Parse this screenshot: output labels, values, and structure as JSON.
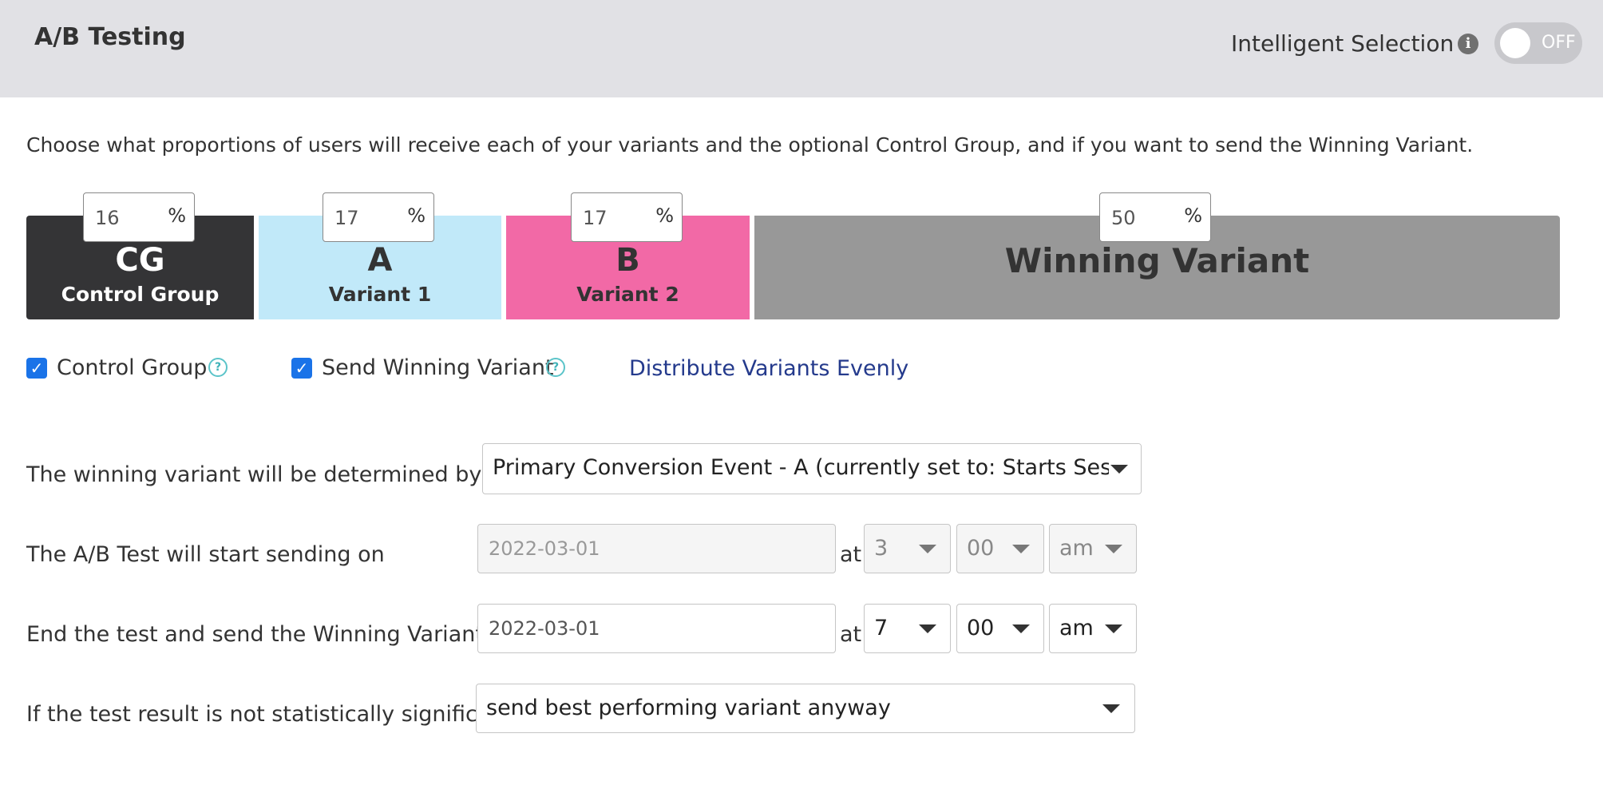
{
  "header": {
    "title": "A/B Testing",
    "intelligent_selection_label": "Intelligent Selection",
    "toggle_label": "OFF"
  },
  "description": "Choose what proportions of users will receive each of your variants and the optional Control Group, and if you want to send the Winning Variant.",
  "segments": [
    {
      "short": "CG",
      "name": "Control Group",
      "percent": "16",
      "color": "#343436"
    },
    {
      "short": "A",
      "name": "Variant 1",
      "percent": "17",
      "color": "#c1e9f9"
    },
    {
      "short": "B",
      "name": "Variant 2",
      "percent": "17",
      "color": "#f269a6"
    },
    {
      "short": "Winning Variant",
      "name": "",
      "percent": "50",
      "color": "#989898"
    }
  ],
  "percent_sign": "%",
  "options": {
    "control_group_label": "Control Group",
    "control_group_checked": true,
    "send_winning_label": "Send Winning Variant",
    "send_winning_checked": true,
    "distribute_link": "Distribute Variants Evenly"
  },
  "form": {
    "winning_label": "The winning variant will be determined by:",
    "winning_value": "Primary Conversion Event - A (currently set to: Starts Session)",
    "start_label": "The A/B Test will start sending on",
    "start_date": "2022-03-01",
    "start_hour": "3",
    "start_minute": "00",
    "start_ampm": "am",
    "end_label": "End the test and send the Winning Variant on",
    "end_date": "2022-03-01",
    "end_hour": "7",
    "end_minute": "00",
    "end_ampm": "am",
    "at_label": "at",
    "significance_label": "If the test result is not statistically significant",
    "significance_value": "send best performing variant anyway"
  }
}
